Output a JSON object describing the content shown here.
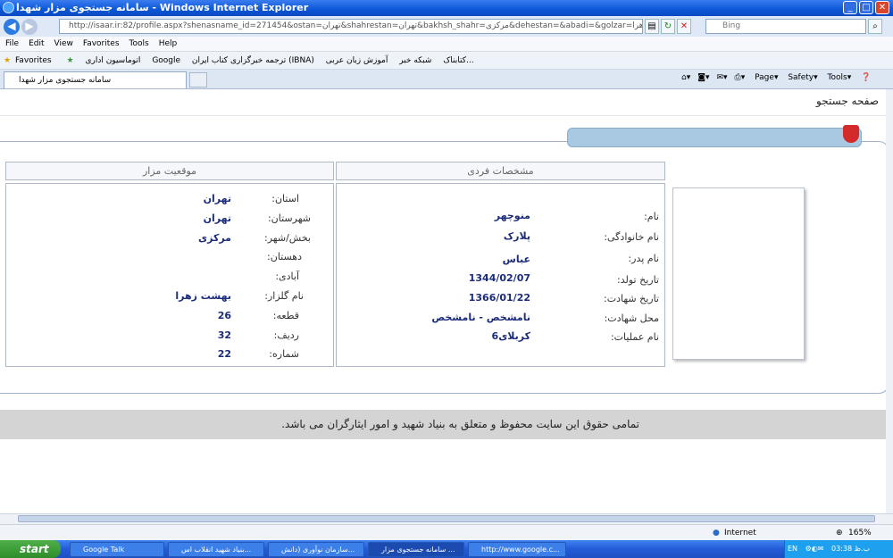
{
  "window": {
    "title": "سامانه جستجوی مزار شهدا - Windows Internet Explorer"
  },
  "address": {
    "url": "http://isaar.ir:82/profile.aspx?shenasname_id=271454&ostan=تهران&shahrestan=تهران&bakhsh_shahr=مرکزی&dehestan=&abadi=&golzar=بهشت زهرا&segment=26&row=32&column=22&px",
    "search_placeholder": "Bing"
  },
  "menu": [
    "File",
    "Edit",
    "View",
    "Favorites",
    "Tools",
    "Help"
  ],
  "favorites": {
    "label": "Favorites",
    "items": [
      "اتوماسیون اداری",
      "Google ترجمه",
      "خبرگزاری کتاب ایران (IBNA)",
      "کتابناک",
      "شبکه خبر",
      "آموزش زبان عربی..."
    ]
  },
  "tab": {
    "label": "سامانه جستجوی مزار شهدا"
  },
  "commandbar": {
    "page": "Page",
    "safety": "Safety",
    "tools": "Tools"
  },
  "page": {
    "heading": "صفحه جستجو",
    "personal": {
      "header": "مشخصات فردی",
      "rows": [
        {
          "label": "نام:",
          "value": "منوچهر"
        },
        {
          "label": "نام خانوادگی:",
          "value": "پلارک"
        },
        {
          "label": "نام پدر:",
          "value": "عباس"
        },
        {
          "label": "تاریخ تولد:",
          "value": "1344/02/07"
        },
        {
          "label": "تاریخ شهادت:",
          "value": "1366/01/22"
        },
        {
          "label": "محل شهادت:",
          "value": "نامشخص - نامشخص"
        },
        {
          "label": "نام عملیات:",
          "value": "کربلای6"
        }
      ]
    },
    "location": {
      "header": "موقعیت مزار",
      "rows": [
        {
          "label": "استان:",
          "value": "تهران"
        },
        {
          "label": "شهرستان:",
          "value": "تهران"
        },
        {
          "label": "بخش/شهر:",
          "value": "مرکزی"
        },
        {
          "label": "دهستان:",
          "value": ""
        },
        {
          "label": "آبادی:",
          "value": ""
        },
        {
          "label": "نام گلزار:",
          "value": "بهشت زهرا"
        },
        {
          "label": "قطعه:",
          "value": "26"
        },
        {
          "label": "ردیف:",
          "value": "32"
        },
        {
          "label": "شماره:",
          "value": "22"
        }
      ]
    },
    "footer": "تمامی حقوق این سایت محفوظ و متعلق به بنیاد شهید و امور ایثارگران می باشد."
  },
  "status": {
    "zone": "Internet",
    "zoom": "165%"
  },
  "taskbar": {
    "start": "start",
    "items": [
      "Google Talk",
      "بنیاد شهید انقلاب اس...",
      "سازمان نوآوری (دانش...",
      "سامانه جستجوی مزار ...",
      "http://www.google.c..."
    ],
    "lang": "EN",
    "time": "03:38 ب.ظ"
  },
  "colors": {
    "titlebar": "#0b56d6",
    "accent_tab": "#a9c9e3",
    "flag": "#d42a2a",
    "value_text": "#1a2c7a"
  }
}
